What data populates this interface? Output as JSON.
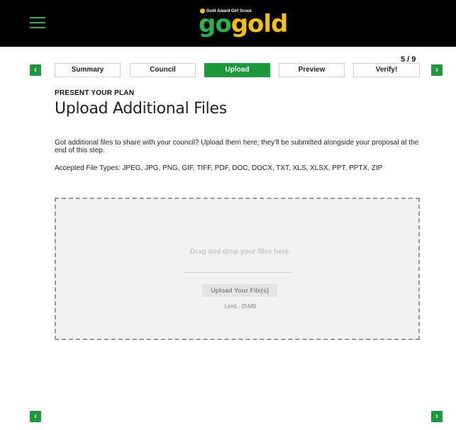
{
  "header": {
    "menu_icon": "hamburger-icon",
    "logo": {
      "tagline": "Gold Award Girl Scout",
      "word_go": "go",
      "word_gold": "gold"
    }
  },
  "progress": {
    "counter": "5 / 9",
    "current": 5,
    "total": 9
  },
  "tabs": [
    {
      "label": "Summary",
      "active": false
    },
    {
      "label": "Council",
      "active": false
    },
    {
      "label": "Upload",
      "active": true
    },
    {
      "label": "Preview",
      "active": false
    },
    {
      "label": "Verify!",
      "active": false
    }
  ],
  "nav": {
    "prev_glyph": "‹",
    "next_glyph": "›"
  },
  "section": {
    "kicker": "PRESENT YOUR PLAN",
    "title": "Upload Additional Files",
    "description": "Got additional files to share with your council? Upload them here; they'll be submitted alongside your proposal at the end of this step.",
    "accepted_types": "Accepted File Types: JPEG, JPG, PNG, GIF, TIFF, PDF, DOC, DOCX, TXT, XLS, XLSX, PPT, PPTX, ZIP"
  },
  "dropzone": {
    "prompt": "Drag and drop your files here.",
    "button_label": "Upload Your File(s)",
    "limit": "Limit : 25MB"
  },
  "colors": {
    "accent_green": "#1a9a3b",
    "logo_gold": "#f6c200",
    "header_bg": "#000000"
  }
}
